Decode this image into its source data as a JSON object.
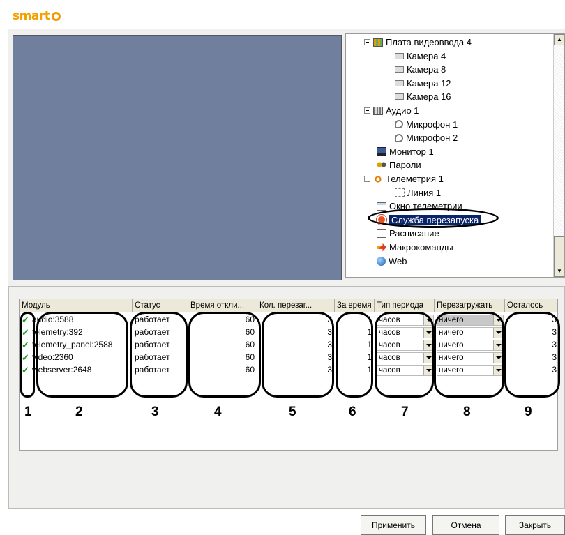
{
  "app": {
    "logo_text": "smart"
  },
  "tree": {
    "items": [
      {
        "label": "Плата видеоввода 4",
        "icon": "video-board-icon"
      },
      {
        "label": "Камера 4",
        "icon": "camera-icon"
      },
      {
        "label": "Камера 8",
        "icon": "camera-icon"
      },
      {
        "label": "Камера 12",
        "icon": "camera-icon"
      },
      {
        "label": "Камера 16",
        "icon": "camera-icon"
      },
      {
        "label": "Аудио 1",
        "icon": "audio-board-icon"
      },
      {
        "label": "Микрофон 1",
        "icon": "microphone-icon"
      },
      {
        "label": "Микрофон 2",
        "icon": "microphone-icon"
      },
      {
        "label": "Монитор 1",
        "icon": "monitor-icon"
      },
      {
        "label": "Пароли",
        "icon": "passwords-icon"
      },
      {
        "label": "Телеметрия 1",
        "icon": "telemetry-icon"
      },
      {
        "label": "Линия 1",
        "icon": "line-icon"
      },
      {
        "label": "Окно телеметрии",
        "icon": "telemetry-window-icon"
      },
      {
        "label": "Служба перезапуска",
        "icon": "restart-service-icon",
        "selected": true
      },
      {
        "label": "Расписание",
        "icon": "schedule-icon"
      },
      {
        "label": "Макрокоманды",
        "icon": "macro-icon"
      },
      {
        "label": "Web",
        "icon": "web-icon"
      }
    ]
  },
  "table": {
    "headers": [
      "Модуль",
      "Статус",
      "Время откли...",
      "Кол. перезаг...",
      "За время",
      "Тип периода",
      "Перезагружать",
      "Осталось"
    ],
    "rows": [
      {
        "module": "audio:3588",
        "status": "работает",
        "response": "60",
        "restarts": "3",
        "period": "1",
        "period_type": "часов",
        "restart": "ничего",
        "left": "3"
      },
      {
        "module": "telemetry:392",
        "status": "работает",
        "response": "60",
        "restarts": "3",
        "period": "1",
        "period_type": "часов",
        "restart": "ничего",
        "left": "3"
      },
      {
        "module": "telemetry_panel:2588",
        "status": "работает",
        "response": "60",
        "restarts": "3",
        "period": "1",
        "period_type": "часов",
        "restart": "ничего",
        "left": "3"
      },
      {
        "module": "video:2360",
        "status": "работает",
        "response": "60",
        "restarts": "3",
        "period": "1",
        "period_type": "часов",
        "restart": "ничего",
        "left": "3"
      },
      {
        "module": "webserver:2648",
        "status": "работает",
        "response": "60",
        "restarts": "3",
        "period": "1",
        "period_type": "часов",
        "restart": "ничего",
        "left": "3"
      }
    ]
  },
  "annotations": [
    "1",
    "2",
    "3",
    "4",
    "5",
    "6",
    "7",
    "8",
    "9"
  ],
  "buttons": {
    "apply": "Применить",
    "cancel": "Отмена",
    "close": "Закрыть"
  }
}
